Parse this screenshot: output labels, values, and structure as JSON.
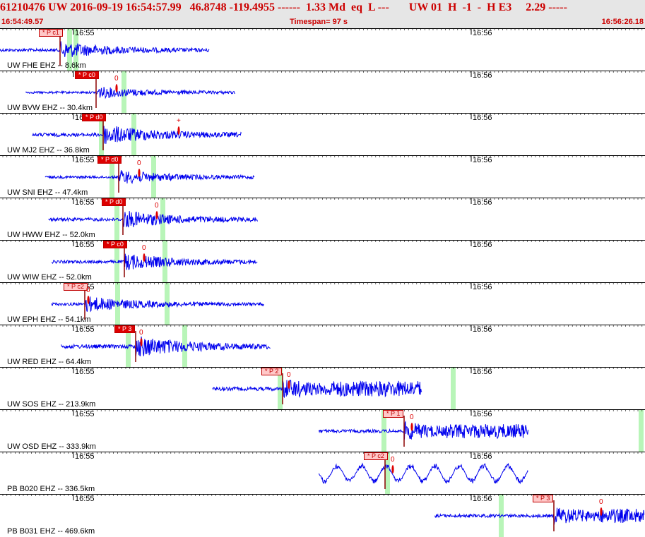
{
  "header": {
    "event_line": "61210476 UW 2016-09-19 16:54:57.99   46.8748 -119.4955 ------  1.33 Md  eq  L ---       UW 01  H  -1  -  H E3     2.29 -----",
    "start_time": "16:54:49.57",
    "timespan": "Timespan=  97 s",
    "end_time": "16:56:26.18"
  },
  "time_ticks": {
    "minute_1": "16:55",
    "minute_2": "16:56"
  },
  "colors": {
    "trace": "#0000ee",
    "pick": "#dd0000",
    "pick_light": "#ffc8c8",
    "green_band": "#b8f5b8",
    "header_text": "#cc0000"
  },
  "channels": [
    {
      "label": "UW FHE EHZ -- 8.6km",
      "pick": "P c1",
      "pick_style": "light",
      "coda": "",
      "trace_start": 0.0,
      "trace_end": 0.325,
      "amp": 0.42
    },
    {
      "label": "UW BVW EHZ -- 30.4km",
      "pick": "P c0",
      "pick_style": "solid",
      "coda": "0",
      "trace_start": 0.04,
      "trace_end": 0.365,
      "amp": 0.3
    },
    {
      "label": "UW MJ2 EHZ -- 36.8km",
      "pick": "P d0",
      "pick_style": "solid",
      "coda": "+",
      "trace_start": 0.05,
      "trace_end": 0.375,
      "amp": 0.5
    },
    {
      "label": "UW SNI EHZ -- 47.4km",
      "pick": "P d0",
      "pick_style": "solid",
      "coda": "0",
      "trace_start": 0.07,
      "trace_end": 0.395,
      "amp": 0.35
    },
    {
      "label": "UW HWW EHZ -- 52.0km",
      "pick": "P d0",
      "pick_style": "solid",
      "coda": "0",
      "trace_start": 0.075,
      "trace_end": 0.4,
      "amp": 0.45
    },
    {
      "label": "UW WIW EHZ -- 52.0km",
      "pick": "P c0",
      "pick_style": "solid",
      "coda": "0",
      "trace_start": 0.08,
      "trace_end": 0.4,
      "amp": 0.42
    },
    {
      "label": "UW EPH EHZ -- 54.1km",
      "pick": "P c2",
      "pick_style": "light",
      "coda": "0",
      "trace_start": 0.08,
      "trace_end": 0.41,
      "amp": 0.4
    },
    {
      "label": "UW RED EHZ -- 64.4km",
      "pick": "P 3",
      "pick_style": "solid",
      "coda": "0",
      "trace_start": 0.095,
      "trace_end": 0.42,
      "amp": 0.55
    },
    {
      "label": "UW SOS EHZ -- 213.9km",
      "pick": "P 2",
      "pick_style": "light",
      "coda": "0",
      "trace_start": 0.33,
      "trace_end": 0.655,
      "amp": 0.5
    },
    {
      "label": "UW OSD EHZ -- 333.9km",
      "pick": "P 1",
      "pick_style": "light",
      "coda": "0",
      "trace_start": 0.495,
      "trace_end": 0.82,
      "amp": 0.45
    },
    {
      "label": "PB B020 EHZ -- 336.5km",
      "pick": "P c2",
      "pick_style": "light",
      "coda": "0",
      "trace_start": 0.495,
      "trace_end": 0.82,
      "amp": 0.55
    },
    {
      "label": "PB B031 EHZ -- 469.6km",
      "pick": "P 3",
      "pick_style": "light",
      "coda": "0",
      "trace_start": 0.675,
      "trace_end": 1.0,
      "amp": 0.45
    }
  ]
}
